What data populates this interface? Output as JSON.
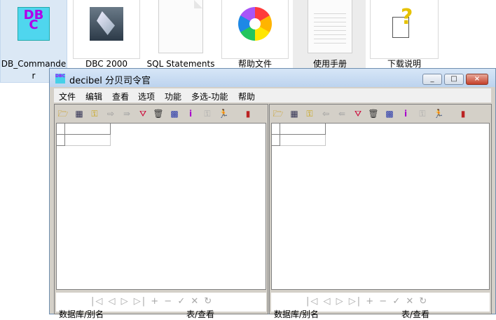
{
  "explorer": {
    "items": [
      {
        "label_line1": "DB_Commande",
        "label_line2": "r",
        "icon": "dbc-app-icon"
      },
      {
        "label": "DBC 2000",
        "icon": "dbc2000-image-icon"
      },
      {
        "label": "SQL Statements",
        "icon": "text-file-icon"
      },
      {
        "label": "帮助文件",
        "icon": "help-pinwheel-icon"
      },
      {
        "label": "使用手册",
        "icon": "text-file-icon"
      },
      {
        "label": "下载说明",
        "icon": "help-document-icon"
      }
    ]
  },
  "window": {
    "icon_text": "DBC",
    "title": "decibel 分贝司令官",
    "controls": {
      "minimize": "_",
      "maximize": "□",
      "close": "×"
    }
  },
  "menu": [
    "文件",
    "编辑",
    "查看",
    "选项",
    "功能",
    "多选-功能",
    "帮助"
  ],
  "panes": [
    {
      "toolbar_icons": [
        "open-folder-icon",
        "table-icon",
        "key-icon",
        "arrow-right-icon",
        "transfer-icon",
        "funnel-icon",
        "trash-icon",
        "grid-icon",
        "info-icon",
        "key-gray-icon",
        "runner-icon",
        "exit-icon"
      ],
      "status_left": "数据库/别名",
      "status_right": "表/查看"
    },
    {
      "toolbar_icons": [
        "open-folder-icon",
        "table-icon",
        "key-icon",
        "arrow-left-icon",
        "transfer-icon",
        "funnel-icon",
        "trash-icon",
        "grid-icon",
        "info-icon",
        "key-gray-icon",
        "runner-icon",
        "exit-icon"
      ],
      "status_left": "数据库/别名",
      "status_right": "表/查看"
    }
  ],
  "navigator_glyphs": "|◁ ◁ ▷ ▷| + − ✓ ✕ ↻"
}
